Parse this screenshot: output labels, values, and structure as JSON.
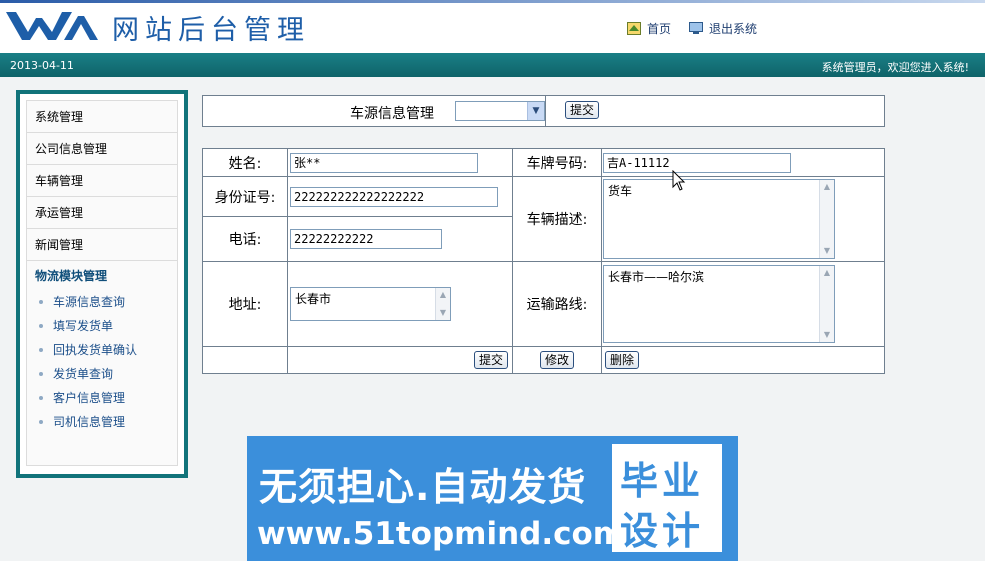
{
  "header": {
    "site_title": "网站后台管理",
    "home_link": "首页",
    "logout_link": "退出系统",
    "home_icon": "home-icon",
    "logout_icon": "monitor-icon"
  },
  "status_bar": {
    "date": "2013-04-11",
    "welcome": "系统管理员，欢迎您进入系统!"
  },
  "sidebar": {
    "items": [
      {
        "label": "系统管理"
      },
      {
        "label": "公司信息管理"
      },
      {
        "label": "车辆管理"
      },
      {
        "label": "承运管理"
      },
      {
        "label": "新闻管理"
      }
    ],
    "group_label": "物流模块管理",
    "sub_items": [
      {
        "label": "车源信息查询"
      },
      {
        "label": "填写发货单"
      },
      {
        "label": "回执发货单确认"
      },
      {
        "label": "发货单查询"
      },
      {
        "label": "客户信息管理"
      },
      {
        "label": "司机信息管理"
      }
    ]
  },
  "toolbar": {
    "label": "车源信息管理",
    "select_value": "",
    "submit": "提交"
  },
  "form": {
    "name_label": "姓名:",
    "name_value": "张**",
    "plate_label": "车牌号码:",
    "plate_value": "吉A-11112",
    "id_label": "身份证号:",
    "id_value": "222222222222222222",
    "vehicle_desc_label": "车辆描述:",
    "vehicle_desc_value": "货车",
    "phone_label": "电话:",
    "phone_value": "22222222222",
    "address_label": "地址:",
    "address_value": "长春市",
    "route_label": "运输路线:",
    "route_value": "长春市——哈尔滨",
    "submit": "提交",
    "modify": "修改",
    "delete": "删除"
  },
  "ad": {
    "line1": "无须担心.自动发货",
    "line2": "www.51topmind.com",
    "badge_line1": "毕业",
    "badge_line2": "设计"
  },
  "colors": {
    "brand_blue": "#1e5ea8",
    "teal": "#11737a",
    "ad_blue": "#3b8fdb"
  }
}
